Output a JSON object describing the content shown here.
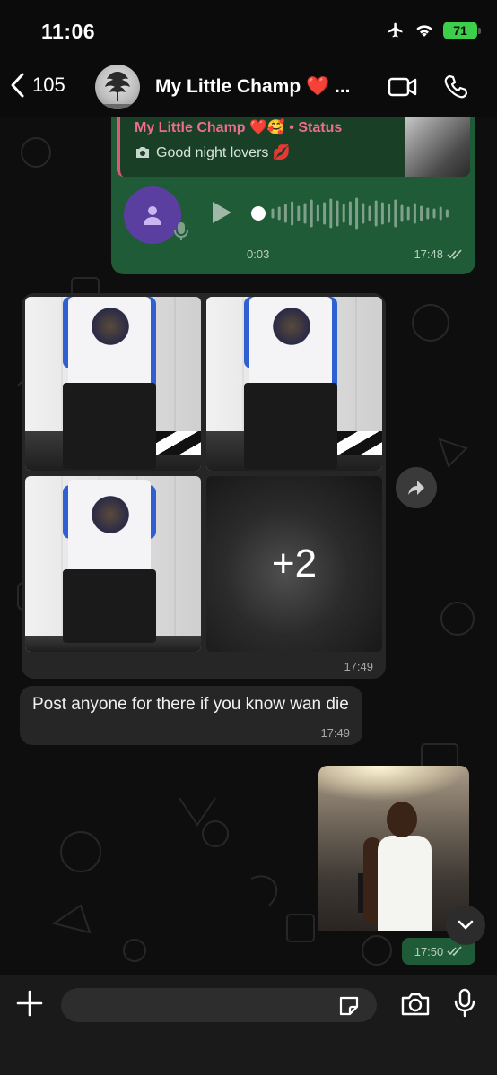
{
  "status_bar": {
    "time": "11:06",
    "battery": "71"
  },
  "header": {
    "back_count": "105",
    "title": "My Little Champ ❤️ ...",
    "icons": [
      "chevron-left-icon",
      "video-call-icon",
      "phone-icon"
    ]
  },
  "messages": {
    "audio_reply": {
      "quote_name": "My Little Champ ❤️🥰 • Status",
      "quote_text": "Good night lovers 💋",
      "duration": "0:03",
      "time": "17:48"
    },
    "photo_group": {
      "more_count": "+2",
      "time": "17:49"
    },
    "text": {
      "body": "Post anyone for there if you know wan die",
      "time": "17:49"
    },
    "video": {
      "time": "17:50"
    }
  },
  "composer": {
    "placeholder": ""
  },
  "colors": {
    "outgoing_bubble": "#1f5b36",
    "incoming_bubble": "#262626",
    "quote_accent": "#e05779",
    "audio_avatar": "#5b3fa0"
  }
}
